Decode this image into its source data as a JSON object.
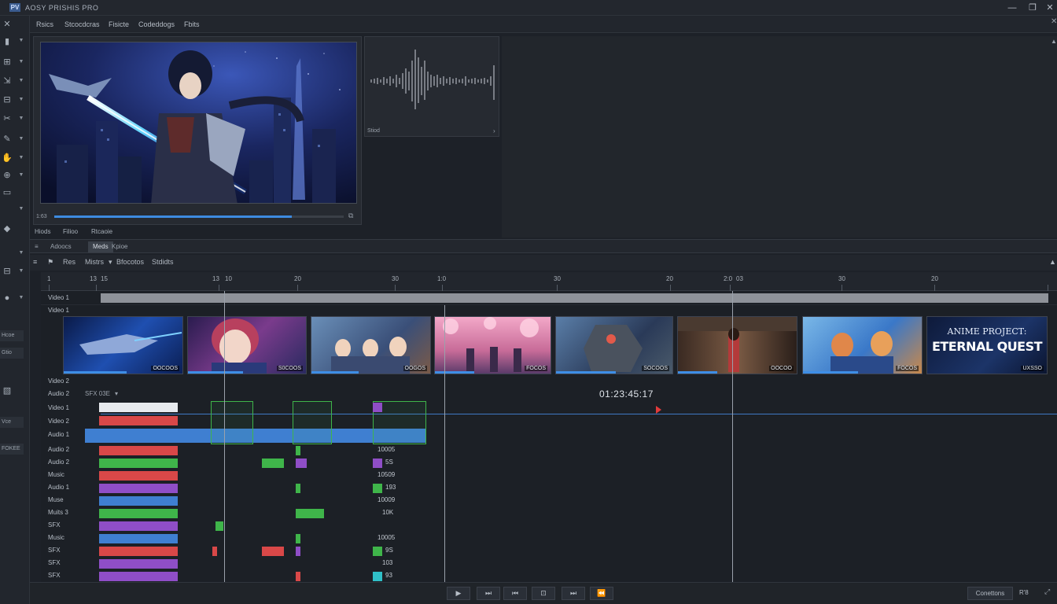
{
  "app": {
    "logo": "PV",
    "title": "AOSY PRISHIS PRO",
    "window_controls": [
      "—",
      "❐",
      "✕"
    ]
  },
  "menu": [
    "Rsics",
    "Stcocdcras",
    "Fisicte",
    "Codeddogs",
    "Fbits"
  ],
  "left_toolbar": {
    "labels": [
      "Hcoe",
      "Gtio",
      "Vce",
      "FOKEE"
    ]
  },
  "viewer": {
    "time": "1:63",
    "progress": 0.82,
    "tabs": [
      "Hiods",
      "Filioo",
      "Rtcaoie"
    ]
  },
  "audio_panel": {
    "label": "Stiod"
  },
  "panel_tabs": [
    "Adoocs",
    "Meds",
    "Kpioe"
  ],
  "timeline_toolbar": {
    "items": [
      "Res",
      "Mistrs",
      "Bfocotos",
      "Stdidts"
    ]
  },
  "ruler": {
    "ticks": [
      "1",
      "13",
      "15",
      "13",
      "10",
      "20",
      "30",
      "1:0",
      "30",
      "20",
      "2:0",
      "03",
      "30",
      "20"
    ]
  },
  "tracks": {
    "labels": [
      "Video 1",
      "Video 1",
      "Video 2",
      "Audio 2",
      "Video 1",
      "Video 2",
      "Audio 1",
      "Audio 2",
      "Audio 2",
      "Music",
      "Audio 1",
      "Muse",
      "Muits 3",
      "SFX",
      "Music",
      "SFX",
      "SFX",
      "SFX"
    ],
    "sub_header": "SFX 03E",
    "thumbs": [
      "OOCOOS",
      "S0COOS",
      "OOGOS",
      "FOCOS",
      "SOCOOS",
      "OOCOO",
      "FOCOS",
      "UXSSO"
    ],
    "title_card": [
      "ANIME PROJECT:",
      "ETERNAL QUEST"
    ],
    "timecode": "01:23:45:17",
    "clip_right_labels": [
      "10005",
      "5S",
      "10509",
      "193",
      "10009",
      "10K",
      "10005",
      "9S",
      "103",
      "93"
    ]
  },
  "bottom": {
    "transport": [
      "▶",
      "⏭",
      "⏮",
      "⊡",
      "⏭",
      "⏪"
    ],
    "conn_label": "Conettons",
    "conn_value": "R'8"
  },
  "colors": {
    "accent_blue": "#3d8be0",
    "clip_red": "#d94848",
    "clip_green": "#3fb54a",
    "clip_purple": "#8f4ec7",
    "clip_blue": "#3f7fd1",
    "playhead_red": "#e13b3b"
  }
}
